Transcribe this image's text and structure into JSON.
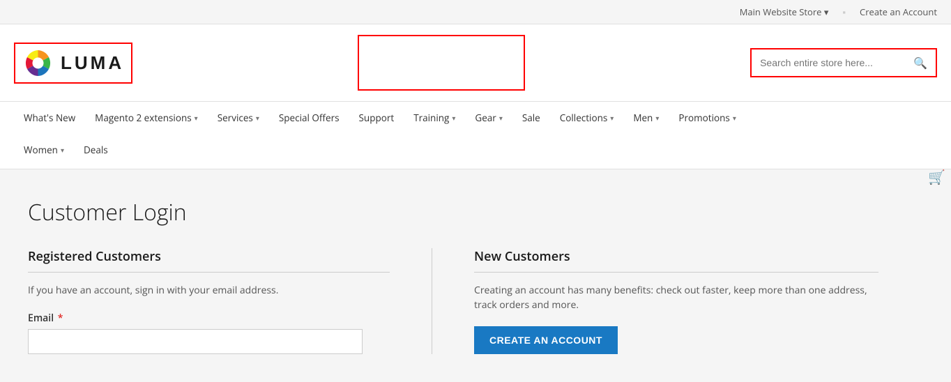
{
  "topbar": {
    "store_label": "Main Website Store",
    "store_arrow": "▾",
    "create_account_label": "Create an Account"
  },
  "header": {
    "logo_text": "LUMA",
    "search_placeholder": "Search entire store here...",
    "search_icon": "🔍"
  },
  "nav": {
    "row1": [
      {
        "label": "What's New",
        "has_dropdown": false
      },
      {
        "label": "Magento 2 extensions",
        "has_dropdown": true
      },
      {
        "label": "Services",
        "has_dropdown": true
      },
      {
        "label": "Special Offers",
        "has_dropdown": false
      },
      {
        "label": "Support",
        "has_dropdown": false
      },
      {
        "label": "Training",
        "has_dropdown": true
      },
      {
        "label": "Gear",
        "has_dropdown": true
      },
      {
        "label": "Sale",
        "has_dropdown": false
      },
      {
        "label": "Collections",
        "has_dropdown": true
      },
      {
        "label": "Men",
        "has_dropdown": true
      },
      {
        "label": "Promotions",
        "has_dropdown": true
      }
    ],
    "row2": [
      {
        "label": "Women",
        "has_dropdown": true
      },
      {
        "label": "Deals",
        "has_dropdown": false
      }
    ]
  },
  "page": {
    "title": "Customer Login",
    "left_col": {
      "title": "Registered Customers",
      "description": "If you have an account, sign in with your email address.",
      "email_label": "Email",
      "email_required": true,
      "email_placeholder": ""
    },
    "right_col": {
      "title": "New Customers",
      "description": "Creating an account has many benefits: check out faster, keep more than one address, track orders and more.",
      "create_account_label": "Create an Account"
    }
  }
}
